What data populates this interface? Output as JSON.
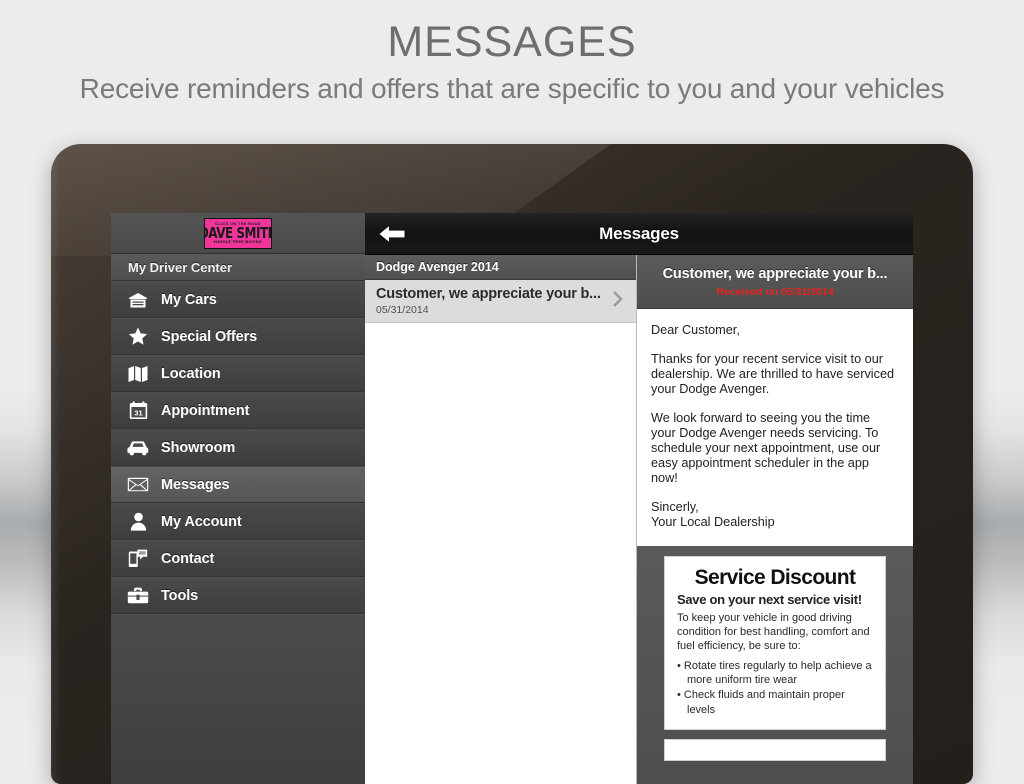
{
  "page": {
    "headline": "MESSAGES",
    "subheadline": "Receive reminders and offers that are specific to you and your vehicles",
    "colors": {
      "accent_pink": "#f0369b",
      "received_red": "#e8231f",
      "sidebar_dark": "#444444",
      "topbar_black": "#151515",
      "page_bg": "#ececed"
    }
  },
  "sidebar": {
    "logo": {
      "top_line": "CLICK ON THE ROAD",
      "brand": "DAVE SMITH",
      "bottom_line": "HASSLE FREE BUYING"
    },
    "header": "My Driver Center",
    "items": [
      {
        "label": "My Cars",
        "icon": "garage-icon",
        "active": false
      },
      {
        "label": "Special Offers",
        "icon": "star-icon",
        "active": false
      },
      {
        "label": "Location",
        "icon": "map-icon",
        "active": false
      },
      {
        "label": "Appointment",
        "icon": "calendar-icon",
        "active": false
      },
      {
        "label": "Showroom",
        "icon": "car-icon",
        "active": false
      },
      {
        "label": "Messages",
        "icon": "envelope-icon",
        "active": true
      },
      {
        "label": "My Account",
        "icon": "person-icon",
        "active": false
      },
      {
        "label": "Contact",
        "icon": "phone-chat-icon",
        "active": false
      },
      {
        "label": "Tools",
        "icon": "toolbox-icon",
        "active": false
      }
    ]
  },
  "topbar": {
    "back_label": "Back",
    "title": "Messages"
  },
  "message_list": {
    "group_header": "Dodge Avenger 2014",
    "rows": [
      {
        "title": "Customer, we appreciate your b...",
        "date": "05/31/2014"
      }
    ]
  },
  "message_detail": {
    "subject": "Customer, we appreciate your b...",
    "received": "Received on 05/31/2014",
    "body": [
      "Dear Customer,",
      "Thanks for your recent service visit to our dealership. We are thrilled to have serviced your Dodge Avenger.",
      "We look forward to seeing you the time your Dodge Avenger needs servicing. To schedule your next appointment, use our easy appointment scheduler in the app now!",
      "Sincerly,\nYour Local Dealership"
    ],
    "coupon": {
      "title": "Service Discount",
      "subtitle": "Save on your next service visit!",
      "text": "To keep your vehicle in good driving condition for best handling, comfort and fuel efficiency, be sure to:",
      "bullets": [
        "Rotate tires regularly to help achieve a more uniform tire wear",
        "Check fluids and maintain proper levels"
      ]
    }
  }
}
